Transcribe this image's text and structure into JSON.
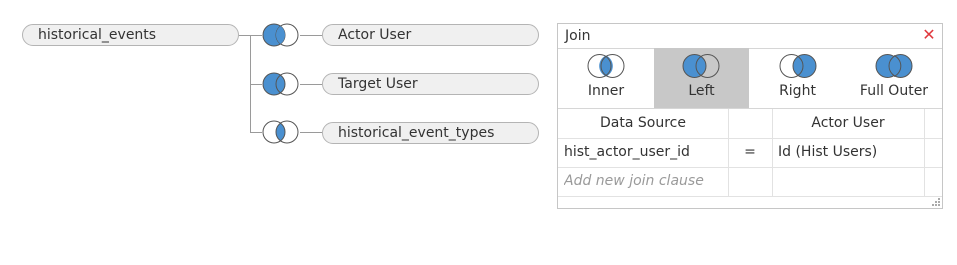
{
  "left_table": {
    "label": "historical_events"
  },
  "joined_tables": [
    {
      "label": "Actor User",
      "join_icon": "left-join-icon"
    },
    {
      "label": "Target User",
      "join_icon": "left-join-icon"
    },
    {
      "label": "historical_event_types",
      "join_icon": "inner-join-icon"
    }
  ],
  "join_panel": {
    "title": "Join",
    "close_icon": "close-icon",
    "join_types": [
      {
        "label": "Inner",
        "icon": "inner-join-icon",
        "selected": false
      },
      {
        "label": "Left",
        "icon": "left-join-icon",
        "selected": true
      },
      {
        "label": "Right",
        "icon": "right-join-icon",
        "selected": false
      },
      {
        "label": "Full Outer",
        "icon": "full-outer-join-icon",
        "selected": false
      }
    ],
    "columns": {
      "left": "Data Source",
      "right": "Actor User"
    },
    "clauses": [
      {
        "left": "hist_actor_user_id",
        "operator": "=",
        "right": "Id (Hist Users)"
      }
    ],
    "add_clause_placeholder": "Add new join clause"
  },
  "colors": {
    "join_fill": "#4a90d0",
    "selected_bg": "#c8c8c8",
    "close": "#e0393e"
  }
}
